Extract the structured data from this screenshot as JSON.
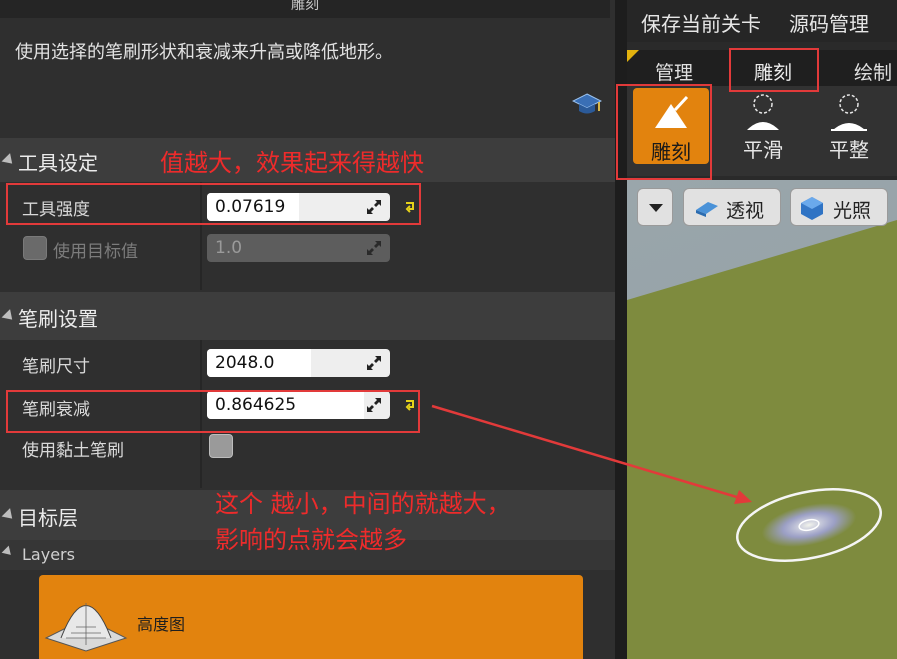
{
  "panel": {
    "header": "雕刻",
    "description": "使用选择的笔刷形状和衰减来升高或降低地形。"
  },
  "tool_settings": {
    "title": "工具设定",
    "strength_label": "工具强度",
    "strength_value": "0.07619",
    "strength_fraction": 0.5,
    "use_target_label": "使用目标值",
    "target_value": "1.0"
  },
  "brush_settings": {
    "title": "笔刷设置",
    "size_label": "笔刷尺寸",
    "size_value": "2048.0",
    "size_fraction": 0.57,
    "falloff_label": "笔刷衰减",
    "falloff_value": "0.864625",
    "falloff_fraction": 0.86,
    "clay_label": "使用黏土笔刷"
  },
  "target_layer": {
    "title": "目标层",
    "layers_label": "Layers",
    "heightmap_label": "高度图"
  },
  "annotations": {
    "strength_note": "值越大，效果起来得越快",
    "falloff_note_line1": "这个 越小，中间的就越大，",
    "falloff_note_line2": "影响的点就会越多"
  },
  "right": {
    "save_label": "保存当前关卡",
    "source_label": "源码管理",
    "tabs": [
      "管理",
      "雕刻",
      "绘制"
    ],
    "tools": [
      "雕刻",
      "平滑",
      "平整"
    ],
    "view_mode": "透视",
    "lighting": "光照"
  },
  "colors": {
    "accent_orange": "#e2830e",
    "annotation_red": "#e23a3a",
    "reset_yellow": "#e6d21a"
  }
}
